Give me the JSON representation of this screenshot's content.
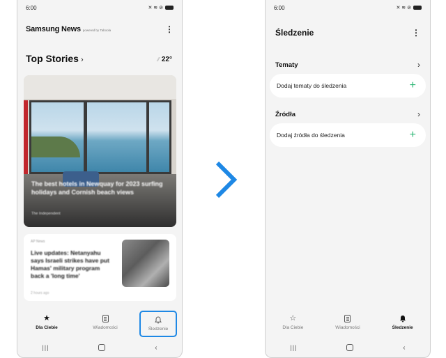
{
  "left": {
    "status": {
      "time": "6:00",
      "icons": "✕ ≋ ⊘"
    },
    "app": {
      "brand": "Samsung News",
      "powered_by": "powered by Taboola"
    },
    "top_stories": {
      "title": "Top Stories",
      "temperature": "22°"
    },
    "hero": {
      "headline": "The best hotels in Newquay for 2023 surfing holidays and Cornish beach views",
      "source": "The Independent"
    },
    "card": {
      "tag": "AP News",
      "headline": "Live updates: Netanyahu says Israeli strikes have put Hamas' military program back a 'long time'",
      "meta": "2 hours ago"
    },
    "nav": [
      {
        "label": "Dla Ciebie",
        "icon": "star-icon"
      },
      {
        "label": "Wiadomości",
        "icon": "news-icon"
      },
      {
        "label": "Śledzenie",
        "icon": "bell-icon"
      }
    ]
  },
  "right": {
    "status": {
      "time": "6:00",
      "icons": "✕ ≋ ⊘"
    },
    "title": "Śledzenie",
    "sections": [
      {
        "label": "Tematy",
        "add_label": "Dodaj tematy do śledzenia"
      },
      {
        "label": "Źródła",
        "add_label": "Dodaj źródła do śledzenia"
      }
    ],
    "nav": [
      {
        "label": "Dla Ciebie",
        "icon": "star-outline-icon"
      },
      {
        "label": "Wiadomości",
        "icon": "news-icon"
      },
      {
        "label": "Śledzenie",
        "icon": "bell-filled-icon"
      }
    ]
  },
  "colors": {
    "accent_blue": "#1e88e5",
    "plus_green": "#2bb673",
    "arrow_blue": "#1e88e5"
  }
}
